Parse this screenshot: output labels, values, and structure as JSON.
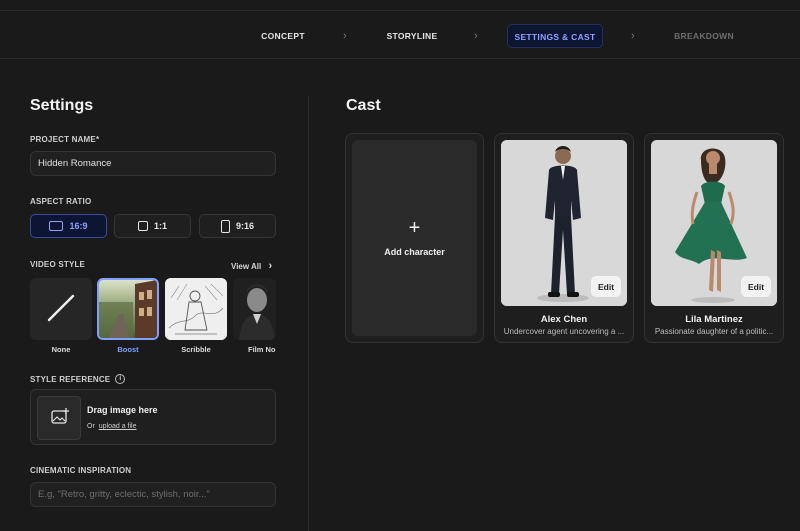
{
  "steps": [
    {
      "label": "CONCEPT"
    },
    {
      "label": "STORYLINE"
    },
    {
      "label": "SETTINGS & CAST"
    },
    {
      "label": "BREAKDOWN"
    }
  ],
  "settings": {
    "title": "Settings",
    "project_name_label": "PROJECT NAME*",
    "project_name_value": "Hidden Romance",
    "aspect_ratio_label": "ASPECT RATIO",
    "aspect_ratios": [
      "16:9",
      "1:1",
      "9:16"
    ],
    "aspect_ratio_selected": "16:9",
    "video_style_label": "VIDEO STYLE",
    "view_all_label": "View All",
    "styles": [
      "None",
      "Boost",
      "Scribble",
      "Film Noir"
    ],
    "style_selected": "Boost",
    "style_reference_label": "STYLE REFERENCE",
    "drag_title": "Drag image here",
    "drag_or": "Or",
    "upload_link": "upload a file",
    "cinematic_label": "CINEMATIC INSPIRATION",
    "cinematic_placeholder": "E.g, \"Retro, gritty, eclectic, stylish, noir...\""
  },
  "cast": {
    "title": "Cast",
    "add_label": "Add character",
    "characters": [
      {
        "name": "Alex Chen",
        "description": "Undercover agent uncovering a ...",
        "edit_label": "Edit"
      },
      {
        "name": "Lila Martinez",
        "description": "Passionate daughter of a politic...",
        "edit_label": "Edit"
      }
    ]
  },
  "colors": {
    "background": "#1a1a1a",
    "accent": "#7ea0ff",
    "active_step_bg": "#0d1533"
  }
}
